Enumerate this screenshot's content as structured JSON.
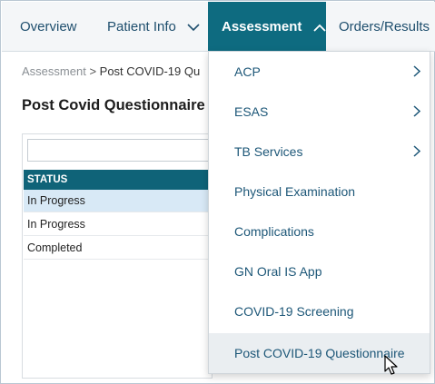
{
  "nav": {
    "items": [
      {
        "label": "Overview"
      },
      {
        "label": "Patient Info"
      },
      {
        "label": "Assessment"
      },
      {
        "label": "Orders/Results"
      }
    ]
  },
  "breadcrumb": {
    "parent": "Assessment",
    "separator": ">",
    "current": "Post COVID-19 Qu"
  },
  "page": {
    "title": "Post Covid Questionnaire"
  },
  "table": {
    "filter_placeholder": "",
    "header": "STATUS",
    "rows": [
      {
        "status": "In Progress",
        "selected": true
      },
      {
        "status": "In Progress",
        "selected": false
      },
      {
        "status": "Completed",
        "selected": false
      }
    ]
  },
  "dropdown": {
    "items": [
      {
        "label": "ACP",
        "has_submenu": true
      },
      {
        "label": "ESAS",
        "has_submenu": true
      },
      {
        "label": "TB Services",
        "has_submenu": true
      },
      {
        "label": "Physical Examination",
        "has_submenu": false
      },
      {
        "label": "Complications",
        "has_submenu": false
      },
      {
        "label": "GN Oral IS App",
        "has_submenu": false
      },
      {
        "label": "COVID-19 Screening",
        "has_submenu": false
      },
      {
        "label": "Post COVID-19 Questionnaire",
        "has_submenu": false,
        "hovered": true
      }
    ]
  },
  "colors": {
    "accent": "#0e6b80",
    "table_header": "#0f6378",
    "link_text": "#1d5778",
    "selected_row": "#d8e9f6"
  }
}
